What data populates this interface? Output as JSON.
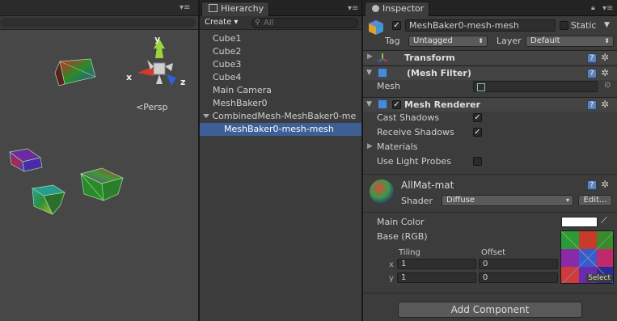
{
  "scene": {
    "persp_label": "Persp",
    "axes": {
      "x": "x",
      "y": "y",
      "z": "z"
    },
    "menu_glyph": "▾≡"
  },
  "hierarchy": {
    "tab_label": "Hierarchy",
    "create_label": "Create ▾",
    "search_placeholder": "All",
    "items": [
      {
        "label": "Cube1"
      },
      {
        "label": "Cube2"
      },
      {
        "label": "Cube3"
      },
      {
        "label": "Cube4"
      },
      {
        "label": "Main Camera"
      },
      {
        "label": "MeshBaker0"
      },
      {
        "label": "CombinedMesh-MeshBaker0-me"
      },
      {
        "label": "MeshBaker0-mesh-mesh"
      }
    ]
  },
  "inspector": {
    "tab_label": "Inspector",
    "object_name": "MeshBaker0-mesh-mesh",
    "static_label": "Static",
    "tag_label": "Tag",
    "tag_value": "Untagged",
    "layer_label": "Layer",
    "layer_value": "Default",
    "transform_title": "Transform",
    "mesh_filter_title": "(Mesh Filter)",
    "mesh_label": "Mesh",
    "mesh_renderer_title": "Mesh Renderer",
    "cast_shadows_label": "Cast Shadows",
    "receive_shadows_label": "Receive Shadows",
    "materials_label": "Materials",
    "use_light_probes_label": "Use Light Probes",
    "material_name": "AllMat-mat",
    "shader_label": "Shader",
    "shader_value": "Diffuse",
    "edit_label": "Edit...",
    "main_color_label": "Main Color",
    "base_rgb_label": "Base (RGB)",
    "tiling_label": "Tiling",
    "offset_label": "Offset",
    "x_label": "x",
    "y_label": "y",
    "tiling_x": "1",
    "tiling_y": "1",
    "offset_x": "0",
    "offset_y": "0",
    "select_label": "Select",
    "add_component_label": "Add Component",
    "help_glyph": "?",
    "gear_glyph": "✲",
    "check_glyph": "✓",
    "lock_glyph": "🔒"
  },
  "colors": {
    "selection": "#3e5f96",
    "scene_bg": "#474747",
    "panel_bg": "#3c3c3c"
  }
}
